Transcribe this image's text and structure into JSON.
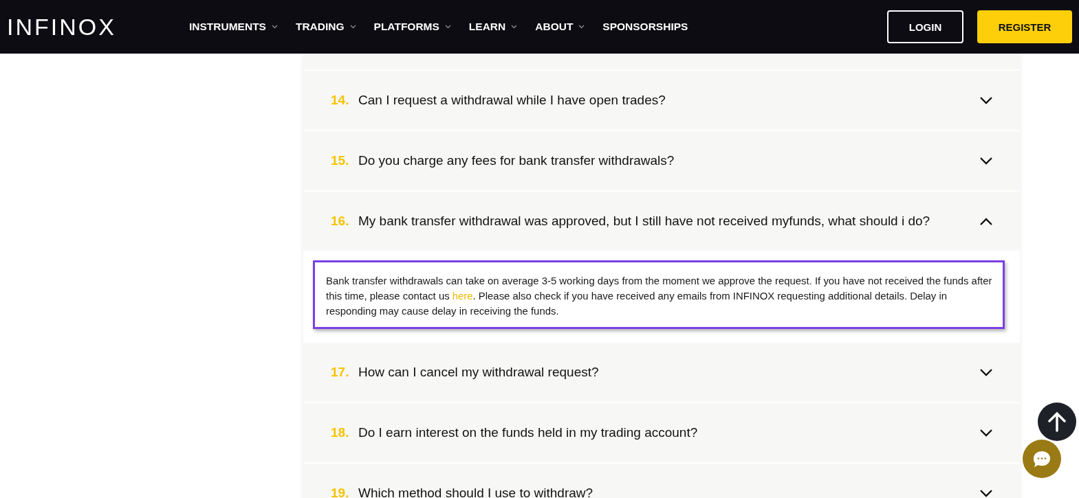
{
  "header": {
    "logo": "INFINOX",
    "nav": [
      {
        "label": "INSTRUMENTS",
        "has_menu": true
      },
      {
        "label": "TRADING",
        "has_menu": true
      },
      {
        "label": "PLATFORMS",
        "has_menu": true
      },
      {
        "label": "LEARN",
        "has_menu": true
      },
      {
        "label": "ABOUT",
        "has_menu": true
      },
      {
        "label": "SPONSORSHIPS",
        "has_menu": false
      }
    ],
    "buttons": [
      {
        "label": "LOGIN",
        "kind": "outline"
      },
      {
        "label": "REGISTER",
        "kind": "primary"
      }
    ]
  },
  "faq": [
    {
      "number": "14.",
      "question": "Can I request a withdrawal while I have open trades?",
      "expanded": false
    },
    {
      "number": "15.",
      "question": "Do you charge any fees for bank transfer withdrawals?",
      "expanded": false
    },
    {
      "number": "16.",
      "question": "My bank transfer withdrawal was approved, but I still have not received myfunds, what should i do?",
      "expanded": true,
      "highlighted": true,
      "answer": {
        "before": "Bank transfer withdrawals can take on average 3-5 working days from the moment we approve the request. If you have not received the funds after this time, please contact us ",
        "link": "here",
        "after": ". Please also check if you have received any emails from INFINOX requesting additional details. Delay in responding may cause delay in receiving the funds."
      }
    },
    {
      "number": "17.",
      "question": "How can I cancel my withdrawal request?",
      "expanded": false
    },
    {
      "number": "18.",
      "question": "Do I earn interest on the funds held in my trading account?",
      "expanded": false
    },
    {
      "number": "19.",
      "question": "Which method should I use to withdraw?",
      "expanded": false
    }
  ]
}
